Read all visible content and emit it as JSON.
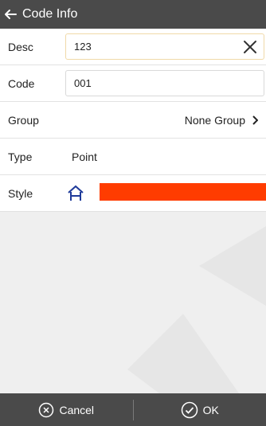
{
  "header": {
    "title": "Code Info",
    "back_icon": "arrow-left-icon"
  },
  "form": {
    "desc": {
      "label": "Desc",
      "value": "123"
    },
    "code": {
      "label": "Code",
      "value": "001"
    },
    "group": {
      "label": "Group",
      "value": "None Group"
    },
    "type": {
      "label": "Type",
      "value": "Point"
    },
    "style": {
      "label": "Style",
      "color": "#ff3c00",
      "icon": "point-symbol-icon"
    }
  },
  "footer": {
    "cancel": "Cancel",
    "ok": "OK"
  },
  "colors": {
    "header": "#4a4a4a",
    "accent": "#ff3c00",
    "icon_blue": "#1e3a9a"
  }
}
